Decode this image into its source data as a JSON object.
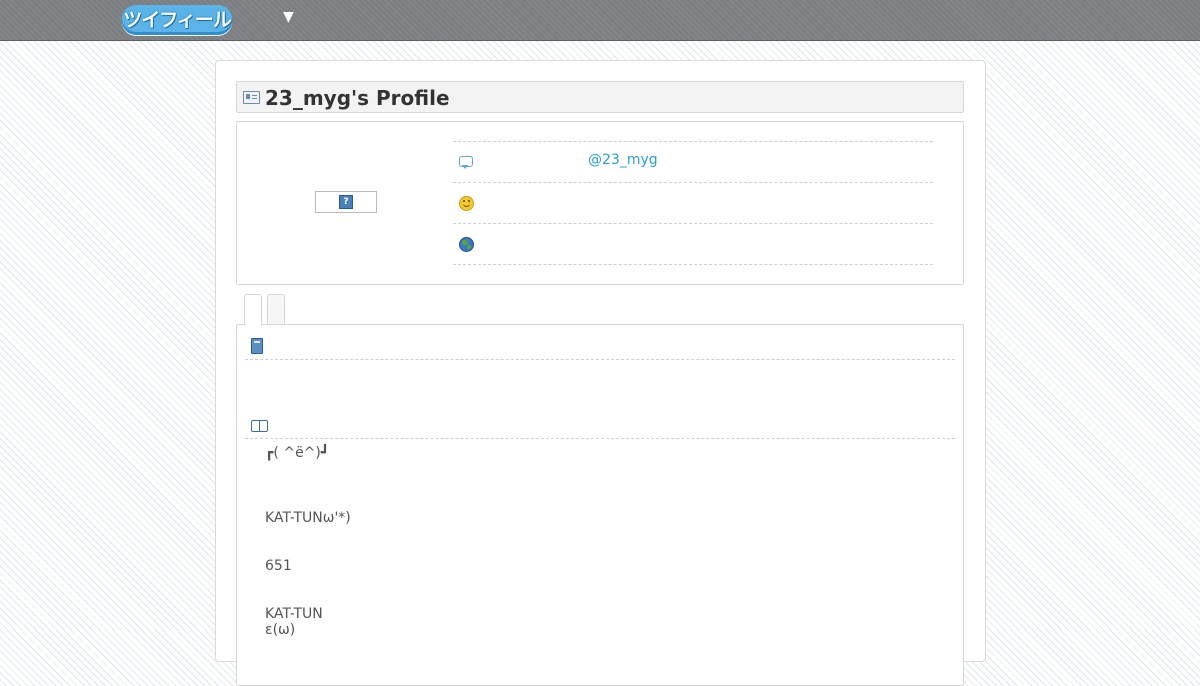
{
  "header": {
    "logo_text": "ツイフィール",
    "menu_toggle": "▼"
  },
  "profile": {
    "title": "23_myg's Profile",
    "avatar_placeholder": "?",
    "rows": [
      {
        "icon": "comment-icon",
        "value": "@23_myg"
      },
      {
        "icon": "smiley-icon",
        "value": ""
      },
      {
        "icon": "globe-icon",
        "value": ""
      }
    ]
  },
  "tabs": [
    {
      "label": ""
    },
    {
      "label": ""
    }
  ],
  "sections": {
    "first_icon": "book-icon",
    "second_icon": "open-book-icon"
  },
  "bio": {
    "lines": [
      "┏( ^ë^)┛",
      "KAT-TUNω'*)",
      "651",
      "KAT-TUN",
      "ε(ω)"
    ]
  },
  "colors": {
    "link": "#2a9fd6",
    "topbar": "#7b7f82",
    "logo": "#5bb4e8"
  }
}
